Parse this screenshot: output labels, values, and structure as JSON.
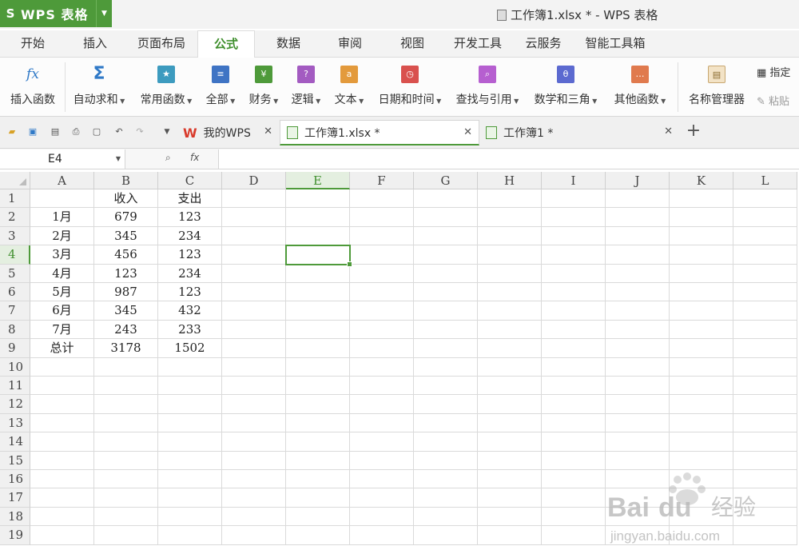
{
  "app": {
    "name": "WPS 表格",
    "logo": "S"
  },
  "window": {
    "title": "工作簿1.xlsx * - WPS 表格"
  },
  "ribbon_tabs": [
    "开始",
    "插入",
    "页面布局",
    "公式",
    "数据",
    "审阅",
    "视图",
    "开发工具",
    "云服务",
    "智能工具箱"
  ],
  "active_ribbon_tab": "公式",
  "ribbon_buttons": [
    {
      "label": "插入函数",
      "icon": "fx-icon",
      "dropdown": false
    },
    {
      "label": "自动求和",
      "icon": "sigma-icon",
      "dropdown": true
    },
    {
      "label": "常用函数",
      "icon": "star-book-icon",
      "dropdown": true
    },
    {
      "label": "全部",
      "icon": "book-icon",
      "dropdown": true
    },
    {
      "label": "财务",
      "icon": "finance-book-icon",
      "dropdown": true
    },
    {
      "label": "逻辑",
      "icon": "logic-book-icon",
      "dropdown": true
    },
    {
      "label": "文本",
      "icon": "text-book-icon",
      "dropdown": true
    },
    {
      "label": "日期和时间",
      "icon": "clock-book-icon",
      "dropdown": true
    },
    {
      "label": "查找与引用",
      "icon": "search-book-icon",
      "dropdown": true
    },
    {
      "label": "数学和三角",
      "icon": "theta-book-icon",
      "dropdown": true
    },
    {
      "label": "其他函数",
      "icon": "more-book-icon",
      "dropdown": true
    },
    {
      "label": "名称管理器",
      "icon": "name-manager-icon",
      "dropdown": false
    }
  ],
  "ribbon_small": {
    "specify": "指定",
    "paste": "粘贴"
  },
  "colors": {
    "accent": "#4e9a3a",
    "selected_header": "#e4efe0"
  },
  "doc_tabs": [
    {
      "label": "我的WPS",
      "icon": "wps-logo-icon",
      "active": false
    },
    {
      "label": "工作簿1.xlsx *",
      "icon": "sheet-file-icon",
      "active": true
    },
    {
      "label": "工作簿1 *",
      "icon": "sheet-file-icon",
      "active": false
    }
  ],
  "formula_bar": {
    "cell_ref": "E4",
    "fx": "fx",
    "value": ""
  },
  "columns": [
    "A",
    "B",
    "C",
    "D",
    "E",
    "F",
    "G",
    "H",
    "I",
    "J",
    "K",
    "L"
  ],
  "selected_column": "E",
  "rows": [
    "1",
    "2",
    "3",
    "4",
    "5",
    "6",
    "7",
    "8",
    "9",
    "10",
    "11",
    "12",
    "13",
    "14",
    "15",
    "16",
    "17",
    "18",
    "19"
  ],
  "selected_row": "4",
  "cells": [
    [
      "",
      "收入",
      "支出"
    ],
    [
      "1月",
      "679",
      "123"
    ],
    [
      "2月",
      "345",
      "234"
    ],
    [
      "3月",
      "456",
      "123"
    ],
    [
      "4月",
      "123",
      "234"
    ],
    [
      "5月",
      "987",
      "123"
    ],
    [
      "6月",
      "345",
      "432"
    ],
    [
      "7月",
      "243",
      "233"
    ],
    [
      "总计",
      "3178",
      "1502"
    ]
  ],
  "watermark": {
    "brand": "Bai",
    "brand2": "du",
    "cn": "经验",
    "url": "jingyan.baidu.com"
  }
}
